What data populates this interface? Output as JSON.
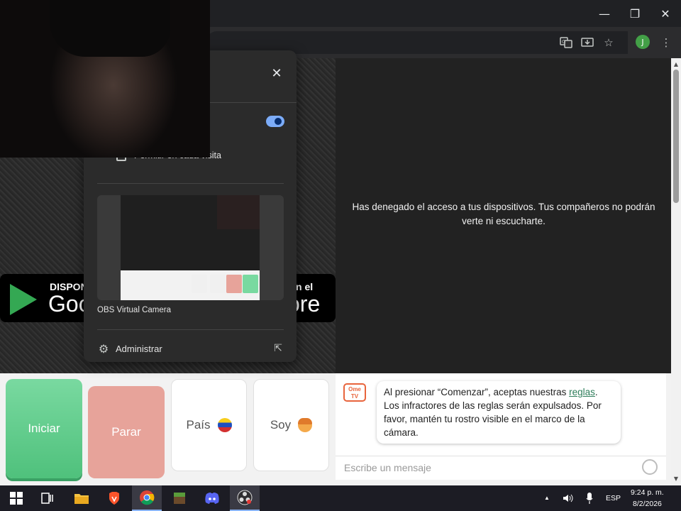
{
  "window": {
    "minimize_glyph": "—",
    "restore_glyph": "❐",
    "close_glyph": "✕"
  },
  "toolbar": {
    "translate_icon": "translate-icon",
    "install_icon": "install-app-icon",
    "bookmark_glyph": "☆",
    "profile_initial": "J",
    "menu_glyph": "⋮"
  },
  "popup": {
    "close_glyph": "✕",
    "toggle_on": true,
    "checkbox_label": "Permitir en cada visita",
    "camera_label": "OBS Virtual Camera",
    "manage_label": "Administrar",
    "manage_glyph": "⚙",
    "open_glyph": "⇱"
  },
  "stores": {
    "google_small": "DISPON",
    "google_big": "Goo",
    "apple_small": "n el",
    "apple_big": "ore"
  },
  "main": {
    "denied_message": "Has denegado el acceso a tus dispositivos. Tus compañeros no podrán verte ni escucharte."
  },
  "controls": {
    "start_label": "Iniciar",
    "stop_label": "Parar",
    "country_label": "País",
    "gender_label": "Soy"
  },
  "chat": {
    "logo_text_1": "Ome",
    "logo_text_2": "TV",
    "rules_prefix": "Al presionar “Comenzar”, aceptas nuestras ",
    "rules_link": "reglas",
    "rules_suffix": ". Los infractores de las reglas serán expulsados. Por favor, mantén tu rostro visible en el marco de la cámara.",
    "input_placeholder": "Escribe un mensaje"
  },
  "taskbar": {
    "apps": [
      "start-icon",
      "task-view-icon",
      "file-explorer-icon",
      "brave-icon",
      "chrome-icon",
      "minecraft-icon",
      "discord-icon",
      "obs-icon"
    ],
    "tray_caret": "▲",
    "language": "ESP",
    "time": "9:24 p. m.",
    "date": "8/2/2026"
  }
}
